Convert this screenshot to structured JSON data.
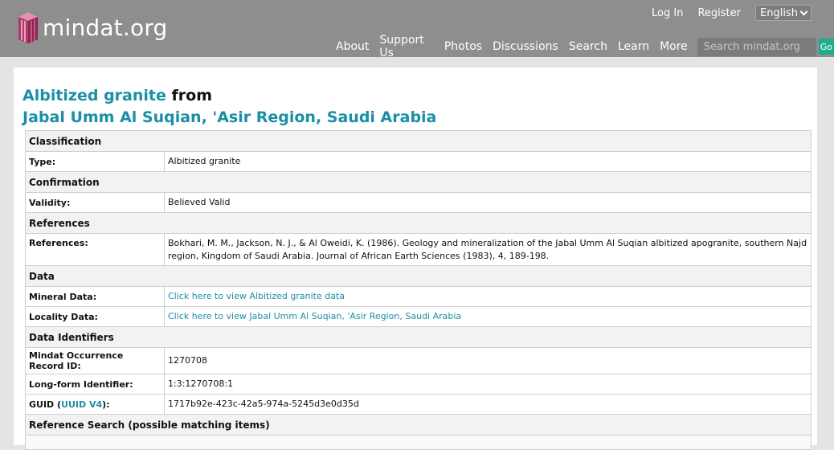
{
  "header": {
    "logo_text": "mindat.org",
    "login": "Log In",
    "register": "Register",
    "language": "English",
    "nav": [
      "About",
      "Support Us",
      "Photos",
      "Discussions",
      "Search",
      "Learn",
      "More"
    ],
    "search_placeholder": "Search mindat.org",
    "go": "Go"
  },
  "page": {
    "title_link": "Albitized granite",
    "title_from": " from",
    "locality": "Jabal Umm Al Suqian, 'Asir Region, Saudi Arabia"
  },
  "table": {
    "classification": "Classification",
    "type_label": "Type:",
    "type_value": "Albitized granite",
    "confirmation": "Confirmation",
    "validity_label": "Validity:",
    "validity_value": "Believed Valid",
    "references_header": "References",
    "references_label": "References:",
    "references_value": "Bokhari, M. M., Jackson, N. J., & Al Oweidi, K. (1986). Geology and mineralization of the Jabal Umm Al Suqian albitized apogranite, southern Najd region, Kingdom of Saudi Arabia. Journal of African Earth Sciences (1983), 4, 189-198.",
    "data_header": "Data",
    "mineral_label": "Mineral Data:",
    "mineral_link": "Click here to view Albitized granite data",
    "locality_label": "Locality Data:",
    "locality_link": "Click here to view Jabal Umm Al Suqian, 'Asir Region, Saudi Arabia",
    "identifiers_header": "Data Identifiers",
    "record_label": "Mindat Occurrence Record ID:",
    "record_value": "1270708",
    "longform_label": "Long-form Identifier:",
    "longform_value": "1:3:1270708:1",
    "guid_prefix": "GUID (",
    "guid_link": "UUID V4",
    "guid_suffix": "):",
    "guid_value": "1717b92e-423c-42a5-974a-5245d3e0d35d",
    "refsearch_header": "Reference Search (possible matching items)"
  }
}
